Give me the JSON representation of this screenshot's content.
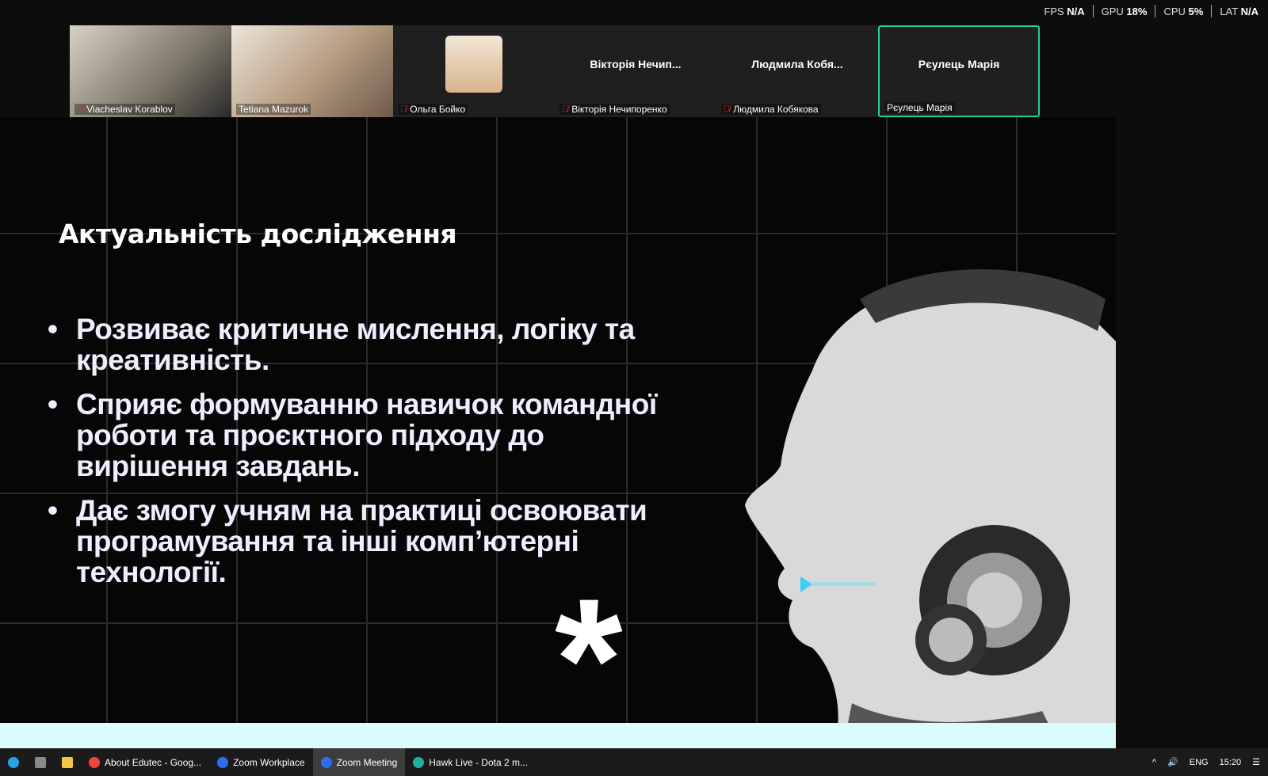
{
  "stats": {
    "fps_label": "FPS",
    "fps": "N/A",
    "gpu_label": "GPU",
    "gpu": "18%",
    "cpu_label": "CPU",
    "cpu": "5%",
    "lat_label": "LAT",
    "lat": "N/A"
  },
  "participants": [
    {
      "name": "Viacheslav Korablov",
      "muted": true
    },
    {
      "name": "Tetiana Mazurok",
      "muted": false
    },
    {
      "name": "Ольга Бойко",
      "muted": true
    },
    {
      "name": "Вікторія Нечипоренко",
      "display": "Вікторія Нечип...",
      "muted": true
    },
    {
      "name": "Людмила Кобякова",
      "display": "Людмила Кобя...",
      "muted": true
    },
    {
      "name": "Рєулець Марія",
      "display": "Рєулець Марія",
      "muted": false,
      "active_speaker": true
    }
  ],
  "slide": {
    "title": "Актуальність дослідження",
    "bullets": [
      "Розвиває критичне мислення, логіку та креативність.",
      "Сприяє формуванню навичок командної роботи та проєктного підходу до вирішення завдань.",
      "Дає змогу учням на практиці освоювати програмування та інші комп’ютерні технології."
    ],
    "asterisk": "*"
  },
  "taskbar": {
    "items": [
      "About Edutec - Goog...",
      "Zoom Workplace",
      "Zoom Meeting",
      "Hawk Live - Dota 2 m..."
    ],
    "lang": "ENG",
    "time": "15:20"
  }
}
